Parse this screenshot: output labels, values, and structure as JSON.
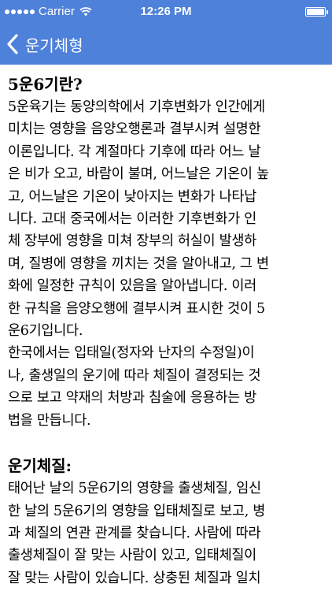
{
  "status_bar": {
    "carrier": "Carrier",
    "time": "12:26 PM",
    "wifi_icon": "wifi-icon",
    "battery_icon": "battery-full-icon",
    "battery_level": 1.0
  },
  "nav": {
    "back_icon": "chevron-left-icon",
    "title": "운기체형",
    "color": "#4e81d9"
  },
  "sections": [
    {
      "title": "5운6기란?",
      "paragraphs": [
        [
          "5운육기는 동양의학에서 기후변화가 인간에게",
          "미치는 영향을 음양오행론과 결부시켜 설명한",
          "이론입니다. 각 계절마다 기후에 따라 어느 날",
          "은 비가 오고, 바람이 불며, 어느날은 기온이 높",
          "고, 어느날은 기온이 낮아지는 변화가 나타납",
          "니다. 고대 중국에서는 이러한 기후변화가 인",
          "체 장부에 영향을 미쳐 장부의 허실이 발생하",
          "며, 질병에 영향을 끼치는 것을 알아내고, 그 변",
          "화에 일정한 규칙이 있음을 알아냅니다. 이러",
          "한 규칙을 음양오행에 결부시켜 표시한 것이 5",
          "운6기입니다."
        ],
        [
          "한국에서는 입태일(정자와 난자의 수정일)이",
          "나, 출생일의 운기에 따라 체질이 결정되는 것",
          "으로 보고 약재의 처방과 침술에 응용하는 방",
          "법을 만듭니다."
        ]
      ]
    },
    {
      "title": "운기체질:",
      "paragraphs": [
        [
          "태어난 날의 5운6기의 영향을 출생체질, 임신",
          "한 날의 5운6기의 영향을 입태체질로 보고, 병",
          "과 체질의 연관 관계를 찾습니다. 사람에 따라",
          "출생체질이 잘 맞는 사람이 있고, 입태체질이",
          "잘 맞는 사람이 있습니다. 상충된 체질과 일치"
        ]
      ]
    }
  ]
}
